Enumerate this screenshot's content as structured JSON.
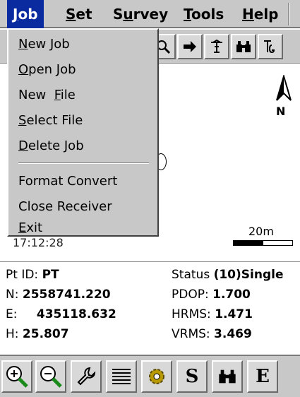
{
  "menubar": {
    "items": [
      {
        "key": "J",
        "rest": "ob"
      },
      {
        "key": "S",
        "rest": "et"
      },
      {
        "pre": "S",
        "key": "u",
        "rest": "rvey"
      },
      {
        "key": "T",
        "rest": "ools"
      },
      {
        "key": "H",
        "rest": "elp"
      }
    ]
  },
  "job_menu": {
    "items": [
      {
        "key": "N",
        "rest": "ew Job"
      },
      {
        "key": "O",
        "rest": "pen Job"
      },
      {
        "pre": "New  ",
        "key": "F",
        "rest": "ile"
      },
      {
        "key": "S",
        "rest": "elect File"
      },
      {
        "key": "D",
        "rest": "elete Job"
      },
      {
        "pre": "Format Convert",
        "key": "",
        "rest": ""
      },
      {
        "pre": "Close Receiver",
        "key": "",
        "rest": ""
      },
      {
        "key": "E",
        "rest": "xit"
      }
    ]
  },
  "toolbar": {
    "icons": [
      "zoom-icon",
      "arrow-right-icon",
      "antenna-icon",
      "binoculars-icon",
      "tg-icon"
    ]
  },
  "map": {
    "north_label": "N",
    "timestamp": "17:12:28",
    "scale_label": "20m"
  },
  "status": {
    "pt_id_label": "Pt ID:",
    "pt_id_value": "PT",
    "status_label": "Status",
    "status_value": "(10)Single",
    "n_label": "N:",
    "n_value": "2558741.220",
    "e_label": "E:",
    "e_value": "435118.632",
    "h_label": "H:",
    "h_value": "25.807",
    "pdop_label": "PDOP:",
    "pdop_value": "1.700",
    "hrms_label": "HRMS:",
    "hrms_value": "1.471",
    "vrms_label": "VRMS:",
    "vrms_value": "3.469"
  },
  "bottombar": {
    "s_label": "S",
    "e_label": "E"
  },
  "colors": {
    "menu_highlight": "#0a2aa0",
    "zoom_green": "#1a8a1a"
  }
}
